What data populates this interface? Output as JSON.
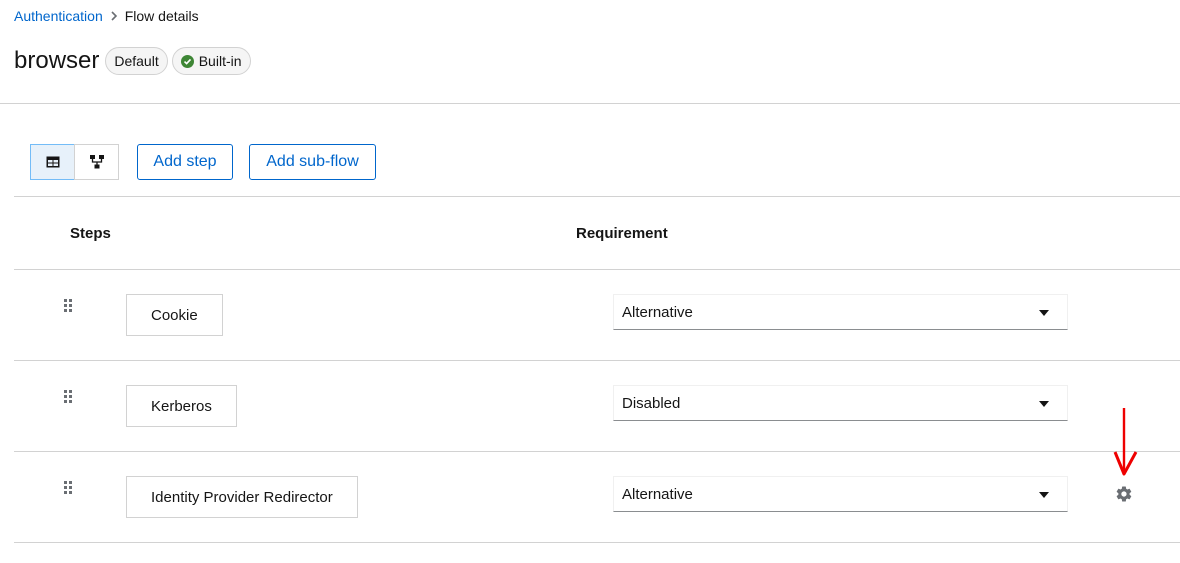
{
  "breadcrumb": {
    "parent": "Authentication",
    "current": "Flow details"
  },
  "header": {
    "title": "browser",
    "badge_default": "Default",
    "badge_builtin": "Built-in"
  },
  "toolbar": {
    "table_view_icon": "table-icon",
    "diagram_view_icon": "diagram-icon",
    "add_step": "Add step",
    "add_subflow": "Add sub-flow"
  },
  "table": {
    "headers": {
      "steps": "Steps",
      "requirement": "Requirement"
    },
    "rows": [
      {
        "name": "Cookie",
        "requirement": "Alternative"
      },
      {
        "name": "Kerberos",
        "requirement": "Disabled"
      },
      {
        "name": "Identity Provider Redirector",
        "requirement": "Alternative"
      }
    ]
  },
  "colors": {
    "link": "#0066cc",
    "success": "#3e8635",
    "annotation_arrow": "#ee0000"
  }
}
